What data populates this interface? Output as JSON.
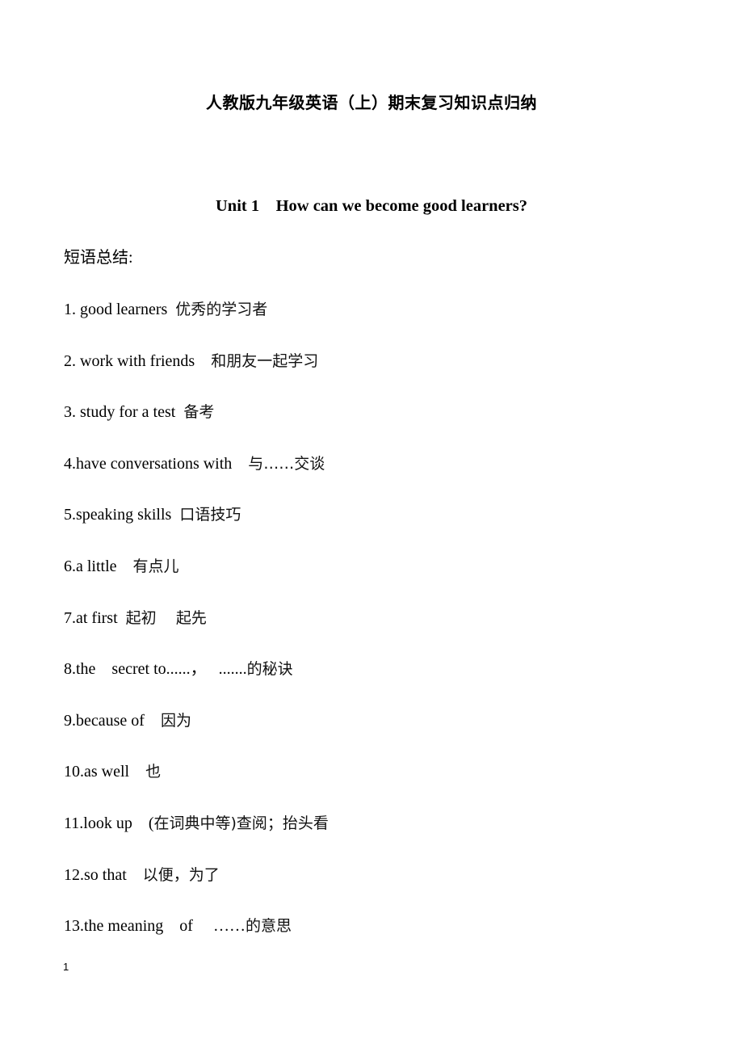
{
  "document": {
    "title": "人教版九年级英语（上）期末复习知识点归纳",
    "unit_title": "Unit 1    How can we become good learners?",
    "section_label": "短语总结:",
    "phrases": [
      {
        "en": "1. good learners  ",
        "cn": "优秀的学习者"
      },
      {
        "en": "2. work with friends    ",
        "cn": "和朋友一起学习"
      },
      {
        "en": "3. study for a test  ",
        "cn": "备考"
      },
      {
        "en": "4.have conversations with    ",
        "cn": "与……交谈"
      },
      {
        "en": "5.speaking skills  ",
        "cn": "口语技巧"
      },
      {
        "en": "6.a little    ",
        "cn": "有点儿"
      },
      {
        "en": "7.at first  ",
        "cn": "起初    起先"
      },
      {
        "en": "8.the    secret to......，   .......",
        "cn": "的秘诀"
      },
      {
        "en": "9.because of    ",
        "cn": "因为"
      },
      {
        "en": "10.as well    ",
        "cn": "也"
      },
      {
        "en": "11.look up    (",
        "cn": "在词典中等)查阅；抬头看"
      },
      {
        "en": "12.so that    ",
        "cn": "以便，为了"
      },
      {
        "en": "13.the meaning    of     ……",
        "cn": "的意思"
      }
    ],
    "page_number": "1"
  }
}
